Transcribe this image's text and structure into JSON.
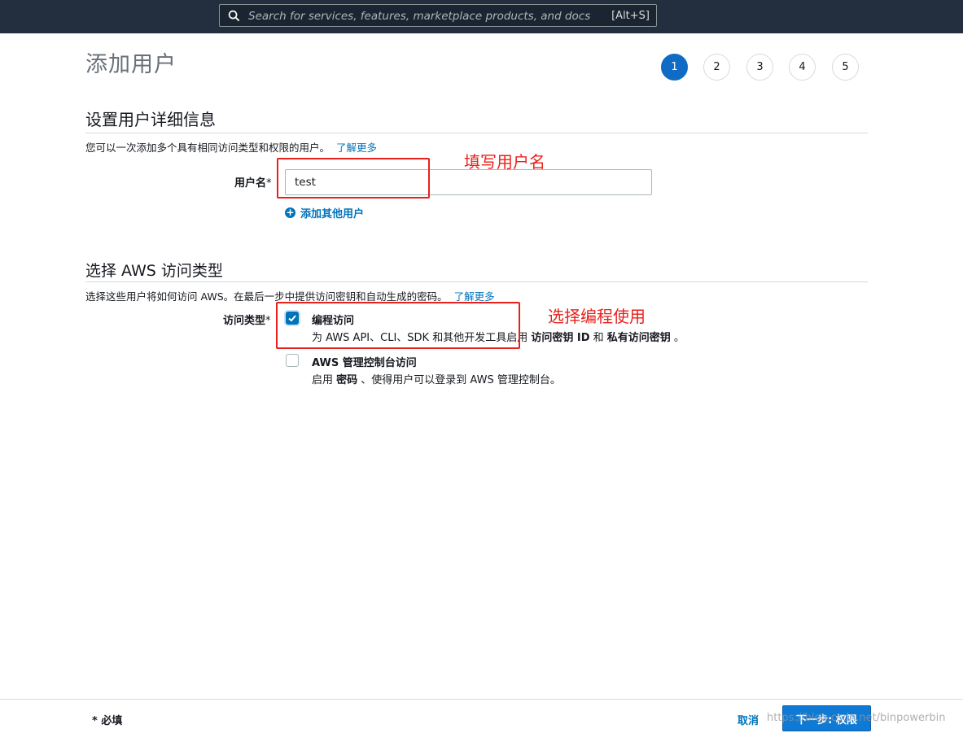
{
  "search": {
    "placeholder": "Search for services, features, marketplace products, and docs",
    "shortcut": "[Alt+S]"
  },
  "page": {
    "title": "添加用户"
  },
  "steps": [
    "1",
    "2",
    "3",
    "4",
    "5"
  ],
  "active_step": 1,
  "user_details": {
    "title": "设置用户详细信息",
    "description": "您可以一次添加多个具有相同访问类型和权限的用户。",
    "learn_more": "了解更多",
    "username_label": "用户名",
    "required_mark": "*",
    "username_value": "test",
    "add_user": "添加其他用户"
  },
  "access_type": {
    "title": "选择 AWS 访问类型",
    "description": "选择这些用户将如何访问 AWS。在最后一步中提供访问密钥和自动生成的密码。",
    "learn_more": "了解更多",
    "label": "访问类型",
    "required_mark": "*",
    "options": [
      {
        "title": "编程访问",
        "desc_prefix": "为 AWS API、CLI、SDK 和其他开发工具启用 ",
        "desc_bold1": "访问密钥 ID",
        "desc_mid": " 和 ",
        "desc_bold2": "私有访问密钥",
        "desc_suffix": " 。",
        "checked": true
      },
      {
        "title": "AWS 管理控制台访问",
        "desc_prefix": "启用 ",
        "desc_bold1": "密码",
        "desc_suffix": " 、使得用户可以登录到 AWS 管理控制台。",
        "checked": false
      }
    ]
  },
  "annotations": {
    "username": "填写用户名",
    "access": "选择编程使用"
  },
  "footer": {
    "required_note": "* 必填",
    "cancel": "取消",
    "next": "下一步: 权限",
    "watermark": "https://blog.csdn.net/binpowerbin"
  },
  "colors": {
    "topbar": "#232f3e",
    "accent": "#0073bb",
    "annotation": "#e8211c"
  }
}
